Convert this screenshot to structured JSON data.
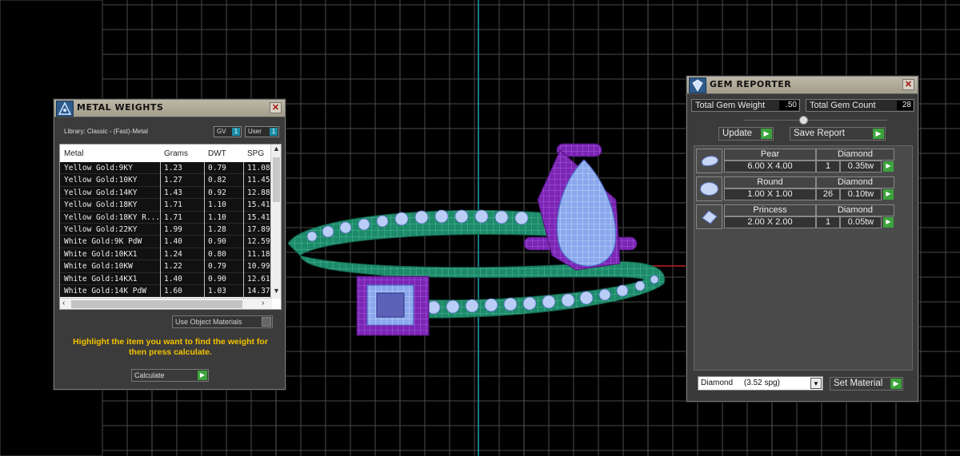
{
  "metal_weights": {
    "title": "METAL WEIGHTS",
    "library": "Library: Classic - (Fast)-Metal",
    "gv_label": "GV",
    "gv_value": "1",
    "user_label": "User",
    "user_value": "1",
    "columns": [
      "Metal",
      "Grams",
      "DWT",
      "SPG"
    ],
    "rows": [
      {
        "metal": "Yellow Gold:9KY",
        "grams": "1.23",
        "dwt": "0.79",
        "spg": "11.08"
      },
      {
        "metal": "Yellow Gold:10KY",
        "grams": "1.27",
        "dwt": "0.82",
        "spg": "11.45"
      },
      {
        "metal": "Yellow Gold:14KY",
        "grams": "1.43",
        "dwt": "0.92",
        "spg": "12.88"
      },
      {
        "metal": "Yellow Gold:18KY",
        "grams": "1.71",
        "dwt": "1.10",
        "spg": "15.41"
      },
      {
        "metal": "Yellow Gold:18KY R...",
        "grams": "1.71",
        "dwt": "1.10",
        "spg": "15.41"
      },
      {
        "metal": "Yellow Gold:22KY",
        "grams": "1.99",
        "dwt": "1.28",
        "spg": "17.89"
      },
      {
        "metal": "White Gold:9K PdW",
        "grams": "1.40",
        "dwt": "0.90",
        "spg": "12.59"
      },
      {
        "metal": "White Gold:10KX1",
        "grams": "1.24",
        "dwt": "0.80",
        "spg": "11.18"
      },
      {
        "metal": "White Gold:10KW",
        "grams": "1.22",
        "dwt": "0.79",
        "spg": "10.99"
      },
      {
        "metal": "White Gold:14KX1",
        "grams": "1.40",
        "dwt": "0.90",
        "spg": "12.61"
      },
      {
        "metal": "White Gold:14K PdW",
        "grams": "1.60",
        "dwt": "1.03",
        "spg": "14.37"
      }
    ],
    "use_object_materials": "Use Object Materials",
    "hint": "Highlight the item you want to find the weight for then press calculate.",
    "calculate_label": "Calculate"
  },
  "gem_reporter": {
    "title": "GEM REPORTER",
    "total_weight_label": "Total Gem Weight",
    "total_weight_value": ".50",
    "total_count_label": "Total Gem Count",
    "total_count_value": "28",
    "update_label": "Update",
    "save_report_label": "Save Report",
    "gems": [
      {
        "shape": "Pear",
        "size": "6.00 X 4.00",
        "material": "Diamond",
        "count": "1",
        "tw": "0.35tw"
      },
      {
        "shape": "Round",
        "size": "1.00 X 1.00",
        "material": "Diamond",
        "count": "26",
        "tw": "0.10tw"
      },
      {
        "shape": "Princess",
        "size": "2.00 X 2.00",
        "material": "Diamond",
        "count": "1",
        "tw": "0.05tw"
      }
    ],
    "material_select": "Diamond     (3.52 spg)",
    "set_material_label": "Set Material"
  },
  "colors": {
    "accent_green": "#3ca33c",
    "highlight_yellow": "#f4c300",
    "ring_green": "#1f8f6e",
    "prong_purple": "#8a2cc4",
    "gem_blue": "#9ab6f0"
  }
}
